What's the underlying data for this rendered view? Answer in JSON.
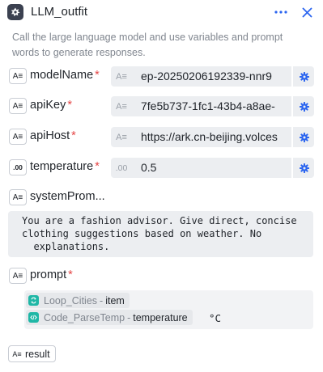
{
  "node": {
    "title": "LLM_outfit",
    "description": "Call the large language model and use variables and prompt words to generate responses."
  },
  "colors": {
    "accent": "#2b65f0",
    "required": "#e54545",
    "chip_icon": "#1fb7a6"
  },
  "params": [
    {
      "label": "modelName",
      "required": "*",
      "type_badge": "A≡",
      "field_type": "A≡",
      "value": "ep-20250206192339-nnr9"
    },
    {
      "label": "apiKey",
      "required": "*",
      "type_badge": "A≡",
      "field_type": "A≡",
      "value": "7fe5b737-1fc1-43b4-a8ae-"
    },
    {
      "label": "apiHost",
      "required": "*",
      "type_badge": "A≡",
      "field_type": "A≡",
      "value": "https://ark.cn-beijing.volces"
    },
    {
      "label": "temperature",
      "required": "*",
      "type_badge": ".00",
      "field_type": ".00",
      "value": "0.5"
    }
  ],
  "system_prompt": {
    "label": "systemProm...",
    "type_badge": "A≡",
    "text": "You are a fashion advisor. Give direct, concise\nclothing suggestions based on weather. No\n  explanations."
  },
  "prompt": {
    "label": "prompt",
    "required": "*",
    "type_badge": "A≡",
    "variables": [
      {
        "node": "Loop_Cities",
        "sep": "-",
        "var": "item",
        "icon": "loop-icon"
      },
      {
        "node": "Code_ParseTemp",
        "sep": "-",
        "var": "temperature",
        "icon": "code-icon"
      }
    ],
    "unit": "°C"
  },
  "output": {
    "label": "result",
    "type_badge": "A≡"
  }
}
